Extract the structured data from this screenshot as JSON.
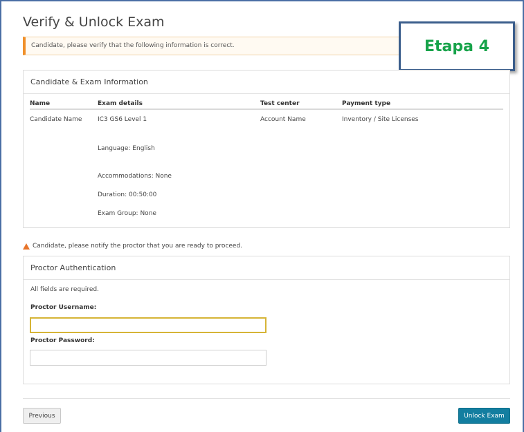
{
  "page": {
    "title": "Verify & Unlock Exam",
    "notice": "Candidate, please verify that the following information is correct.",
    "overlay_label": "Etapa 4"
  },
  "info_panel": {
    "title": "Candidate & Exam Information",
    "columns": {
      "name": "Name",
      "exam_details": "Exam details",
      "test_center": "Test center",
      "payment_type": "Payment type"
    },
    "row": {
      "name": "Candidate Name",
      "exam": "IC3 GS6 Level 1",
      "language": "Language: English",
      "accommodations": "Accommodations: None",
      "duration": "Duration: 00:50:00",
      "exam_group": "Exam Group: None",
      "test_center": "Account Name",
      "payment_type": "Inventory / Site Licenses"
    }
  },
  "proctor_note": "Candidate, please notify the proctor that you are ready to proceed.",
  "proctor_panel": {
    "title": "Proctor Authentication",
    "required_note": "All fields are required.",
    "username_label": "Proctor Username:",
    "username_value": "",
    "password_label": "Proctor Password:",
    "password_value": ""
  },
  "actions": {
    "previous": "Previous",
    "unlock": "Unlock Exam"
  },
  "colors": {
    "accent": "#137ea0",
    "warning": "#f0902a",
    "focus": "#d6b436",
    "overlay_text": "#17a34a",
    "overlay_border": "#3b5e8c"
  }
}
